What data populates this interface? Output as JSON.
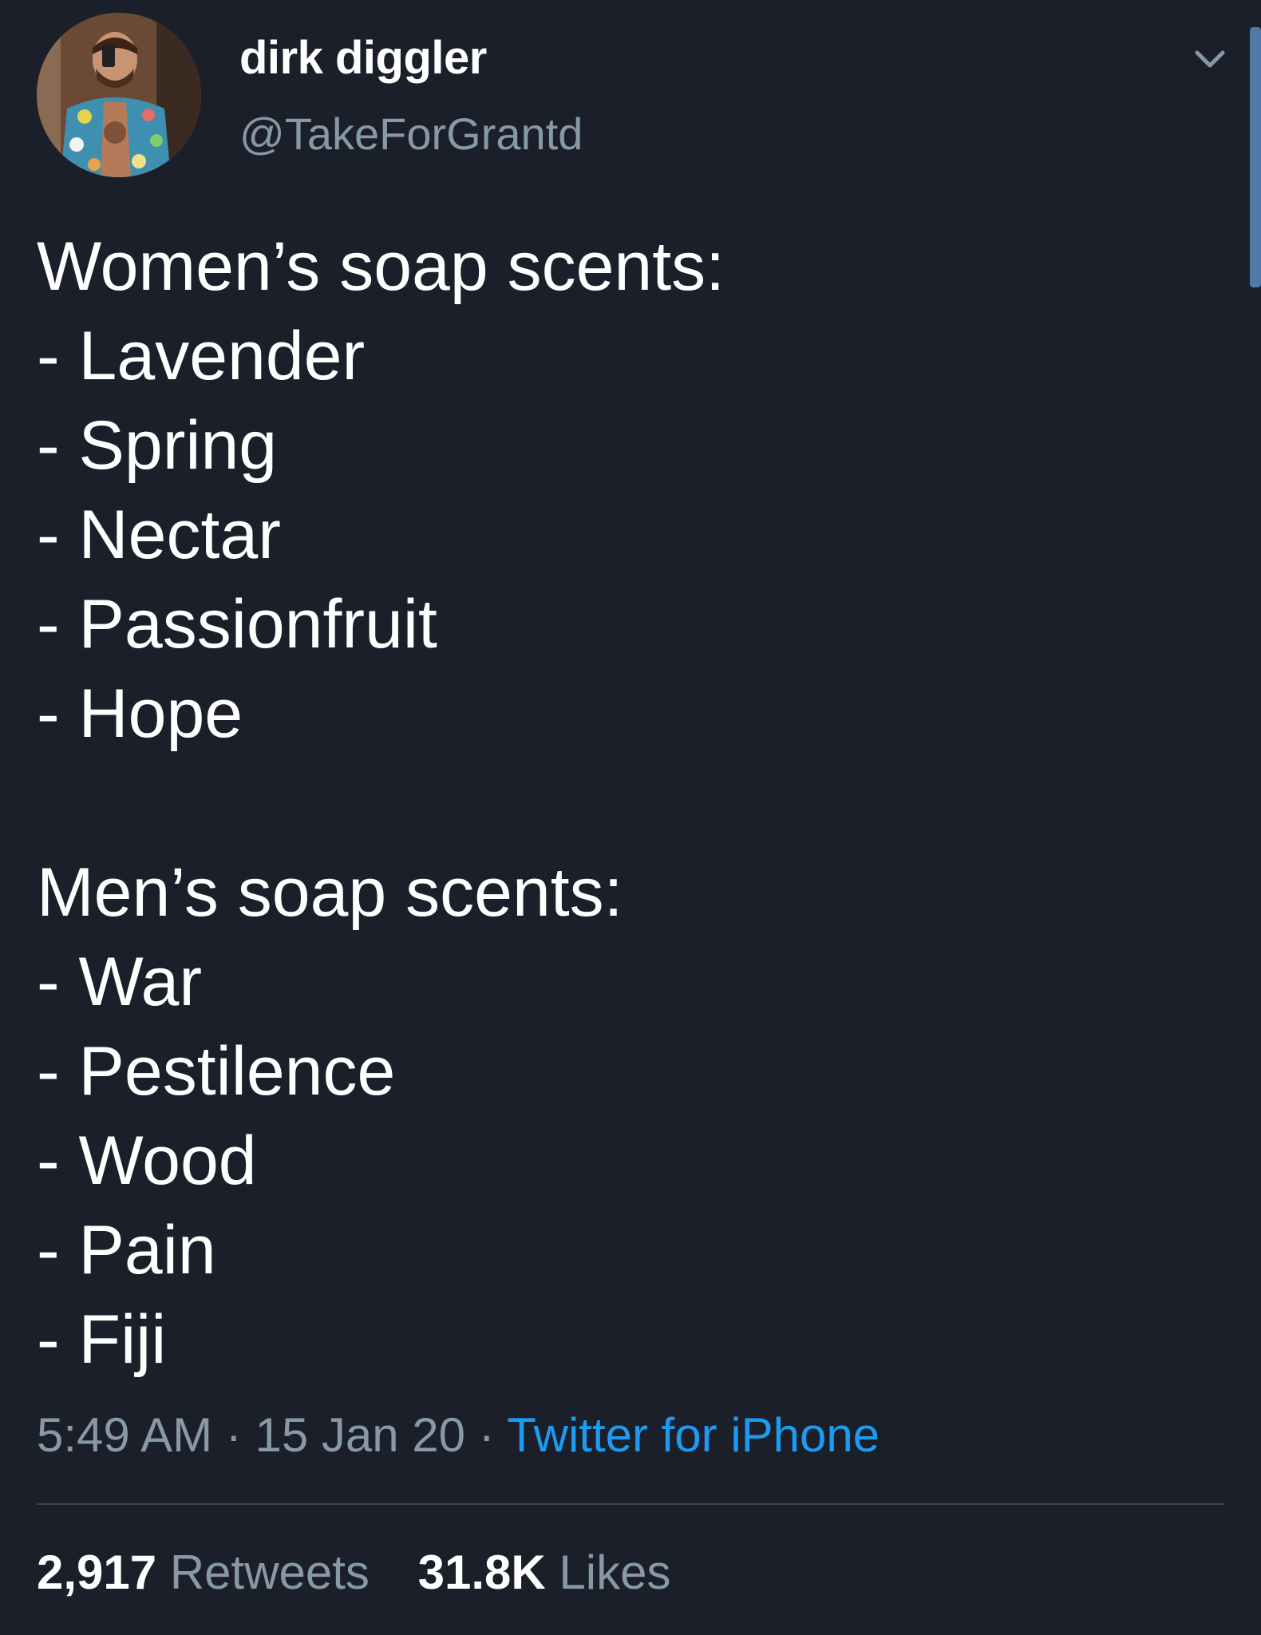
{
  "author": {
    "display_name": "dirk diggler",
    "handle": "@TakeForGrantd"
  },
  "tweet": {
    "lines": [
      "Women’s soap scents:",
      "- Lavender",
      "- Spring",
      "- Nectar",
      "- Passionfruit",
      "- Hope",
      "",
      "Men’s soap scents:",
      "- War",
      "- Pestilence",
      "- Wood",
      "- Pain",
      "- Fiji"
    ]
  },
  "meta": {
    "time": "5:49 AM",
    "separator": " · ",
    "date": "15 Jan 20",
    "source": "Twitter for iPhone"
  },
  "stats": {
    "retweets_count": "2,917",
    "retweets_label": "Retweets",
    "likes_count": "31.8K",
    "likes_label": "Likes"
  },
  "icons": {
    "menu": "chevron-down-icon"
  },
  "colors": {
    "background": "#1a1f2a",
    "secondary_text": "#8899a6",
    "link": "#1d9bf0"
  }
}
